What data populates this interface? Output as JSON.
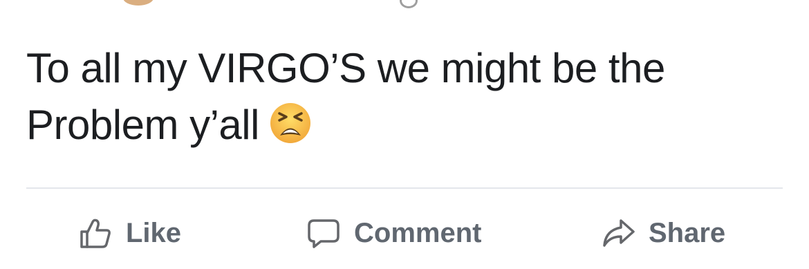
{
  "post": {
    "text_line_1": "To all my VIRGO’S we might be the",
    "text_line_2": "Problem y’all",
    "emoji": "tired-face"
  },
  "actions": {
    "like_label": "Like",
    "comment_label": "Comment",
    "share_label": "Share"
  },
  "colors": {
    "text": "#1c1e21",
    "action_text": "#606770",
    "divider": "#e4e6eb",
    "emoji_face": "#f7c243"
  }
}
